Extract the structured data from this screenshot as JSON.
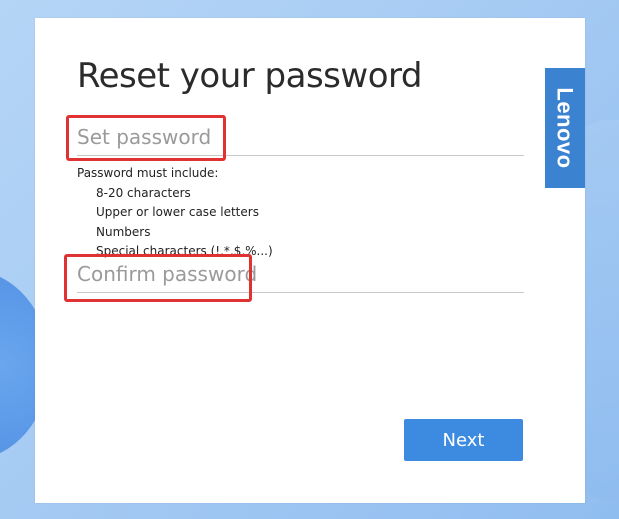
{
  "brand": {
    "name": "Lenovo"
  },
  "title": "Reset your password",
  "set_password": {
    "placeholder": "Set password",
    "value": ""
  },
  "requirements": {
    "heading": "Password must include:",
    "items": [
      "8-20 characters",
      "Upper or lower case letters",
      "Numbers",
      "Special characters  (!,*,$,%...)"
    ]
  },
  "confirm_password": {
    "placeholder": "Confirm password",
    "value": ""
  },
  "next_button": {
    "label": "Next"
  },
  "colors": {
    "accent": "#3d8be0",
    "brand_tab": "#3b82d1",
    "highlight": "#e03232"
  }
}
